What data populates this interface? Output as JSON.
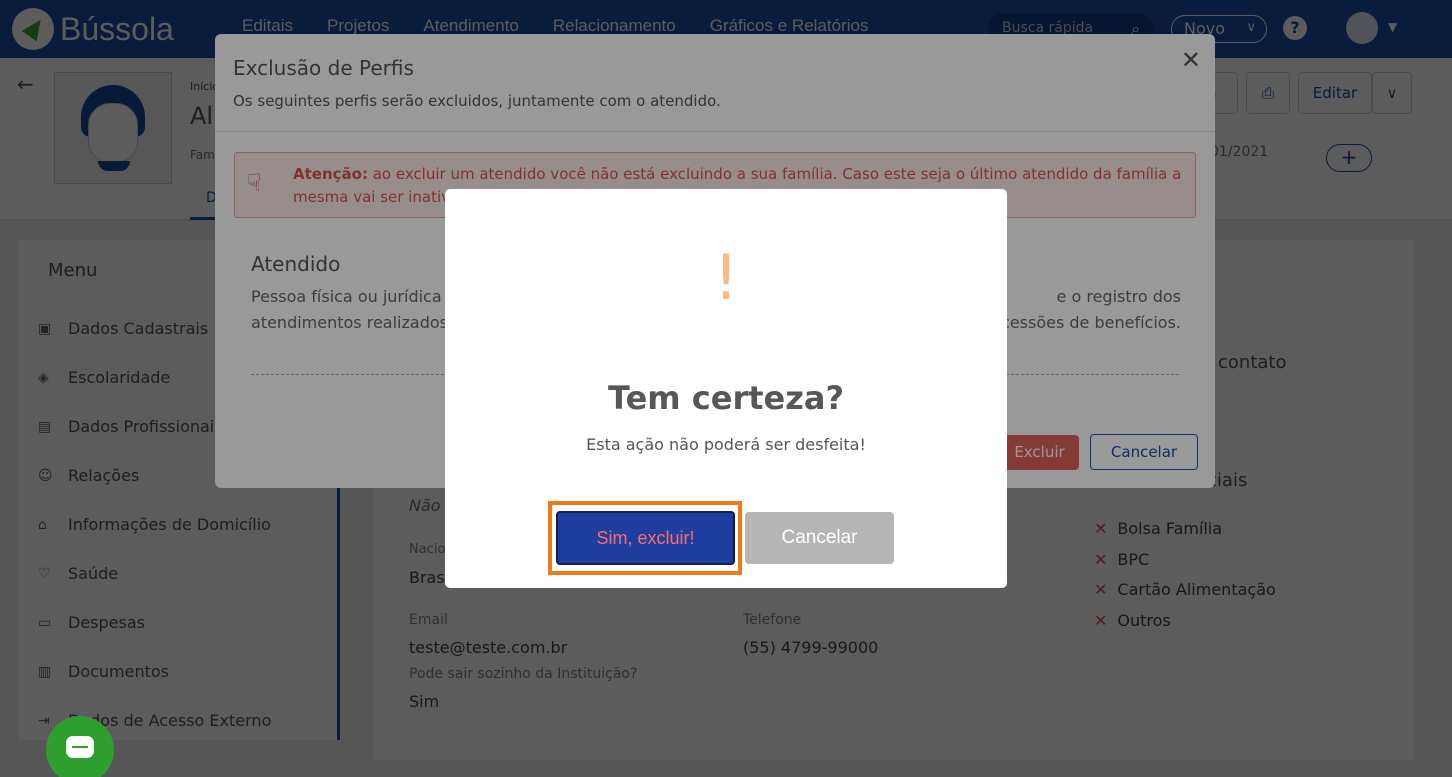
{
  "app": {
    "name": "Bússola"
  },
  "nav": [
    "Editais",
    "Projetos",
    "Atendimento",
    "Relacionamento",
    "Gráficos e Relatórios"
  ],
  "topbar": {
    "search_placeholder": "Busca rápida",
    "novo_label": "Novo",
    "help": "?"
  },
  "profile": {
    "breadcrumb": "Início",
    "name_partial": "Ali",
    "family_partial": "Fam",
    "tab_partial": "D",
    "date_partial": "01/2021",
    "buttons": {
      "partial_label": "a",
      "edit_label": "Editar"
    },
    "plus": "+"
  },
  "sidebar": {
    "title": "Menu",
    "items": [
      {
        "label": "Dados Cadastrais",
        "icon": "id-card-icon"
      },
      {
        "label": "Escolaridade",
        "icon": "graduation-cap-icon"
      },
      {
        "label": "Dados Profissionais",
        "icon": "briefcase-icon"
      },
      {
        "label": "Relações",
        "icon": "users-icon"
      },
      {
        "label": "Informações de Domicílio",
        "icon": "home-icon"
      },
      {
        "label": "Saúde",
        "icon": "heart-pulse-icon"
      },
      {
        "label": "Despesas",
        "icon": "money-icon"
      },
      {
        "label": "Documentos",
        "icon": "document-icon"
      },
      {
        "label": "Dados de Acesso Externo",
        "icon": "sign-in-icon"
      }
    ]
  },
  "main": {
    "contact_partial": "contato",
    "not_partial": "Não",
    "nationality_label_partial": "Nacio",
    "nationality_value_partial": "Brasi",
    "email_label": "Email",
    "email_value": "teste@teste.com.br",
    "phone_label": "Telefone",
    "phone_value": "(55) 4799-99000",
    "leave_label": "Pode sair sozinho da Instituição?",
    "leave_value": "Sim",
    "social_partial": "ociais",
    "benefits": [
      "Bolsa Família",
      "BPC",
      "Cartão Alimentação",
      "Outros"
    ]
  },
  "perfis_modal": {
    "title": "Exclusão de Perfis",
    "subtitle": "Os seguintes perfis serão excluidos, juntamente com o atendido.",
    "alert_strong": "Atenção:",
    "alert_text": " ao excluir um atendido você não está excluindo a sua família. Caso este seja o último atendido da família a mesma vai ser inativada.",
    "section_title": "Atendido",
    "section_text_left": "Pessoa física ou jurídica qu",
    "section_text_right": "e o registro dos",
    "section_text2_left": "atendimentos realizados, t",
    "section_text2_right": "ncessões de benefícios.",
    "delete_label": "Excluir",
    "cancel_label": "Cancelar"
  },
  "confirm": {
    "icon": "!",
    "title": "Tem certeza?",
    "text": "Esta ação não poderá ser desfeita!",
    "confirm_label": "Sim, excluir!",
    "cancel_label": "Cancelar"
  },
  "colors": {
    "brand": "#1a4fa8",
    "danger": "#d9534f",
    "warning_icon": "#f8bb86",
    "highlight": "#f07a1a",
    "chat": "#2e9e2e"
  }
}
